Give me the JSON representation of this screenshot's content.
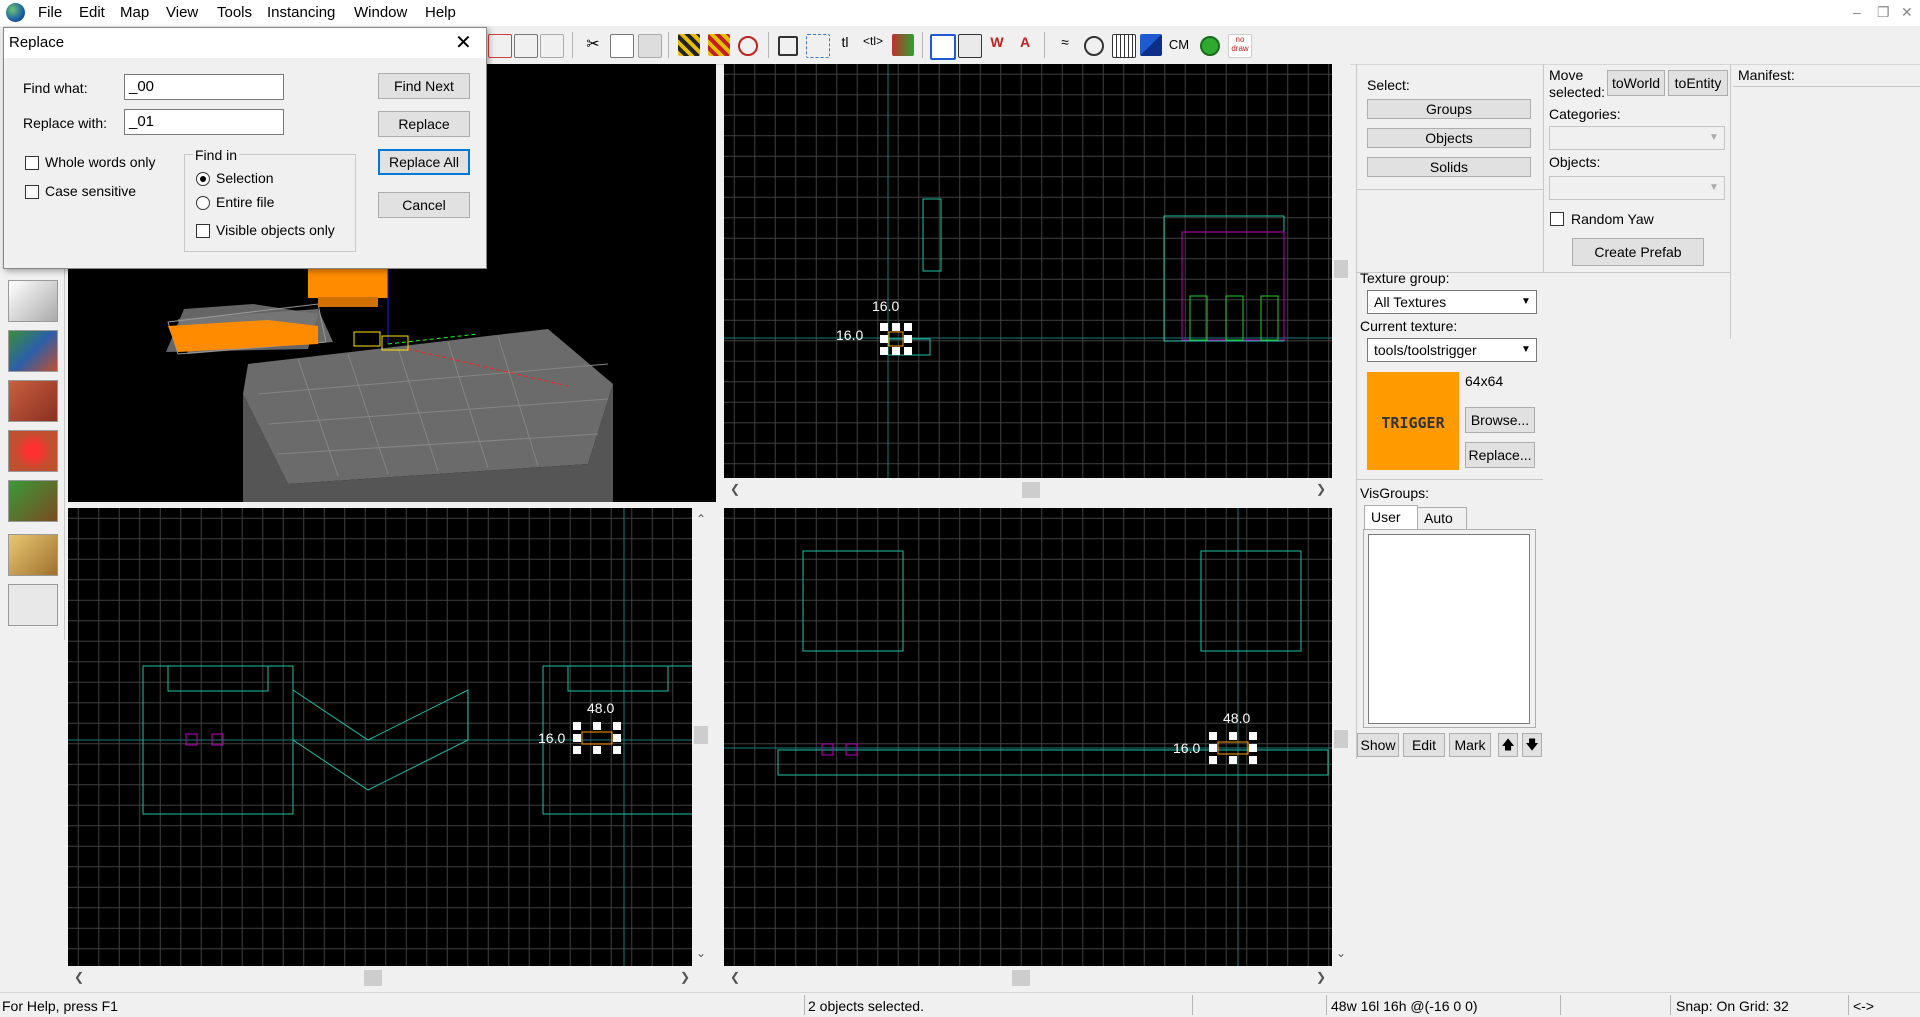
{
  "menu": [
    "File",
    "Edit",
    "Map",
    "View",
    "Tools",
    "Instancing",
    "Window",
    "Help"
  ],
  "dialog": {
    "title": "Replace",
    "find_label": "Find what:",
    "find_value": "_00",
    "replace_label": "Replace with:",
    "replace_value": "_01",
    "whole_words": "Whole words only",
    "case_sensitive": "Case sensitive",
    "find_in": "Find in",
    "opt_selection": "Selection",
    "opt_entire": "Entire file",
    "opt_visible": "Visible objects only",
    "btn_find_next": "Find Next",
    "btn_replace": "Replace",
    "btn_replace_all": "Replace All",
    "btn_cancel": "Cancel"
  },
  "toolbar": {
    "cm_label": "CM",
    "nodraw_label_1": "no",
    "nodraw_label_2": "draw"
  },
  "viewports": {
    "top_right": {
      "dim_top": "16.0",
      "dim_left": "16.0"
    },
    "bottom_left": {
      "dim_top": "48.0",
      "dim_left": "16.0"
    },
    "bottom_right": {
      "dim_top": "48.0",
      "dim_left": "16.0"
    }
  },
  "select_panel": {
    "label": "Select:",
    "groups": "Groups",
    "objects": "Objects",
    "solids": "Solids"
  },
  "move_panel": {
    "label_1": "Move",
    "label_2": "selected:",
    "to_world": "toWorld",
    "to_entity": "toEntity",
    "categories": "Categories:",
    "objects": "Objects:",
    "random_yaw": "Random Yaw",
    "create_prefab": "Create Prefab"
  },
  "manifest": {
    "label": "Manifest:"
  },
  "texture": {
    "group_label": "Texture group:",
    "group_value": "All Textures",
    "current_label": "Current texture:",
    "current_value": "tools/toolstrigger",
    "size": "64x64",
    "preview_text": "TRIGGER",
    "browse": "Browse...",
    "replace": "Replace..."
  },
  "visgroups": {
    "label": "VisGroups:",
    "tab_user": "User",
    "tab_auto": "Auto",
    "show": "Show",
    "edit": "Edit",
    "mark": "Mark",
    "up": "🡅",
    "down": "🡇"
  },
  "status": {
    "help": "For Help, press F1",
    "selection": "2 objects selected.",
    "size": "48w 16l 16h @(-16 0 0)",
    "snap": "Snap: On Grid: 32",
    "arrows": "<->"
  },
  "colors": {
    "grid": "#404040",
    "brush": "#1fbfa8",
    "trigger": "#ff9a00",
    "magenta": "#c000c0"
  }
}
